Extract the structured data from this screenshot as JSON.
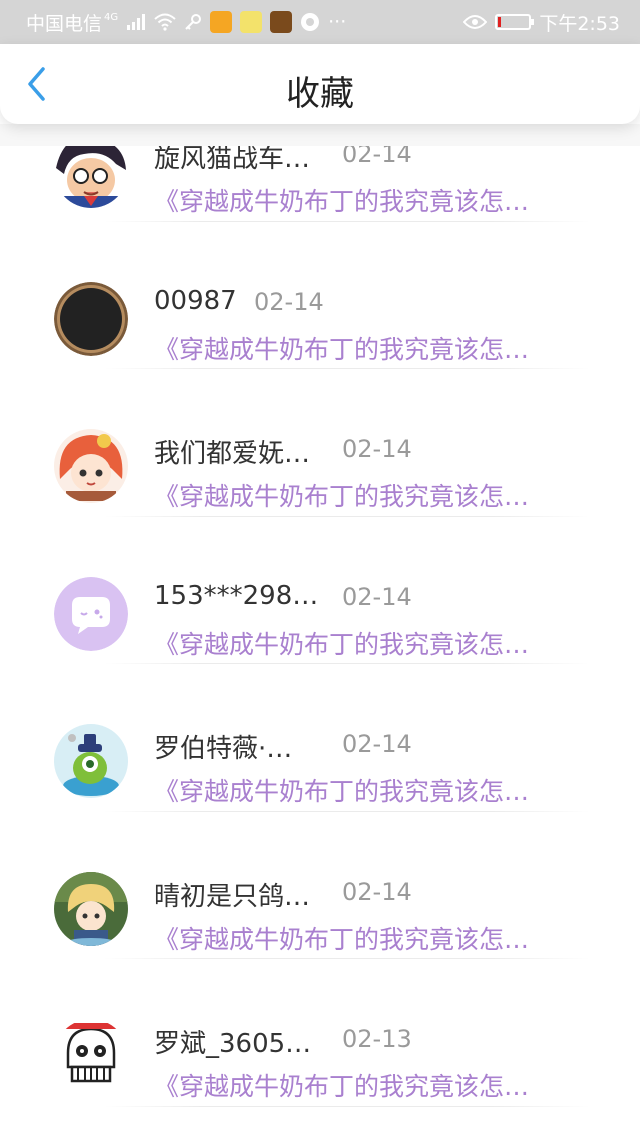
{
  "status_bar": {
    "carrier": "中国电信",
    "network": "4G",
    "time": "下午2:53",
    "battery_level": 0.08,
    "colors": {
      "background": "#d5d5d5",
      "text": "#ffffff",
      "battery_low": "#e02020"
    }
  },
  "nav": {
    "title": "收藏",
    "back_icon": "chevron-left-icon",
    "accent": "#3a9ee8"
  },
  "favorites": [
    {
      "name": "旋风猫战车…",
      "date": "02-14",
      "snippet": "《穿越成牛奶布丁的我究竟该怎…",
      "avatar": "anime-boy-glasses-avatar"
    },
    {
      "name": "00987",
      "date": "02-14",
      "snippet": "《穿越成牛奶布丁的我究竟该怎…",
      "avatar": "black-circle-avatar"
    },
    {
      "name": "我们都爱妩…",
      "date": "02-14",
      "snippet": "《穿越成牛奶布丁的我究竟该怎…",
      "avatar": "red-hair-girl-avatar"
    },
    {
      "name": "153***298…",
      "date": "02-14",
      "snippet": "《穿越成牛奶布丁的我究竟该怎…",
      "avatar": "default-chat-bubble-avatar"
    },
    {
      "name": "罗伯特薇·…",
      "date": "02-14",
      "snippet": "《穿越成牛奶布丁的我究竟该怎…",
      "avatar": "green-monster-avatar"
    },
    {
      "name": "晴初是只鸽…",
      "date": "02-14",
      "snippet": "《穿越成牛奶布丁的我究竟该怎…",
      "avatar": "blonde-anime-avatar"
    },
    {
      "name": "罗斌_3605…",
      "date": "02-13",
      "snippet": "《穿越成牛奶布丁的我究竟该怎…",
      "avatar": "skull-meme-avatar"
    }
  ],
  "colors": {
    "snippet": "#a980cf",
    "date": "#9a9a9a",
    "name": "#333333"
  }
}
